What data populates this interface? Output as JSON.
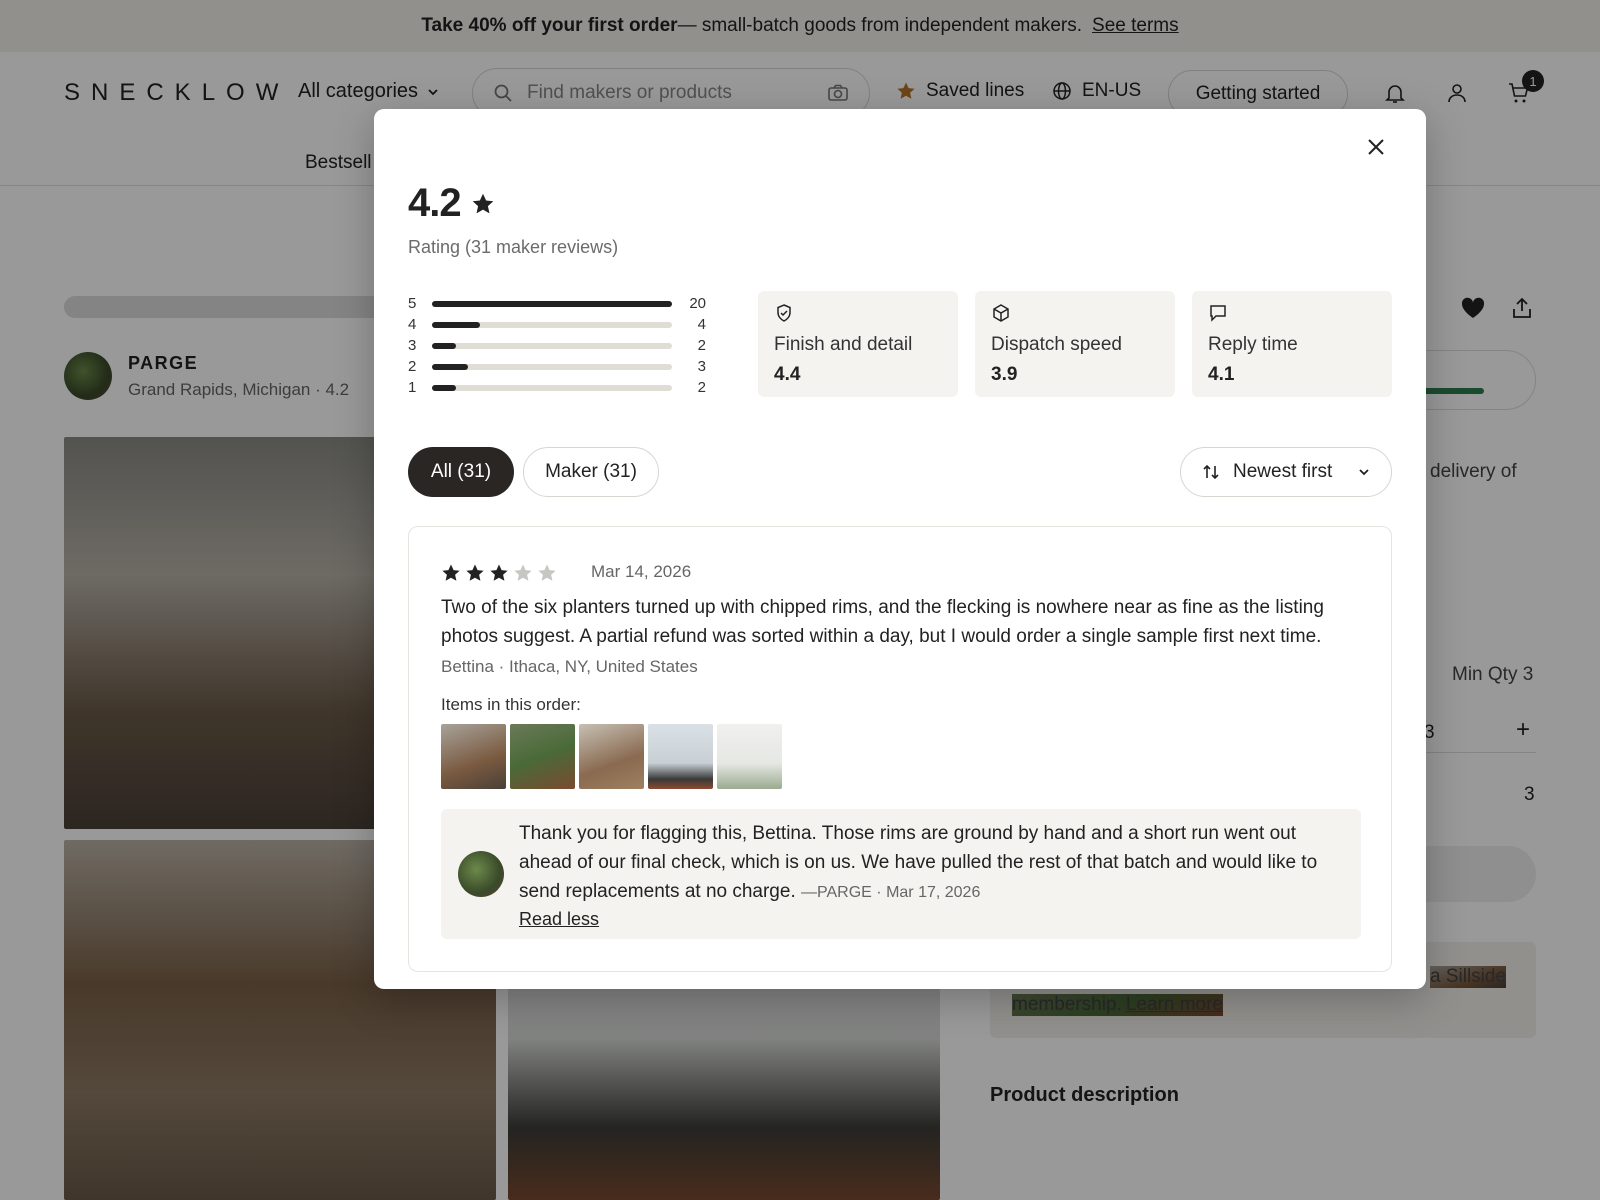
{
  "promo": {
    "bold": "Take 40% off your first order",
    "rest": " — small-batch goods from independent makers.",
    "link": "See terms"
  },
  "header": {
    "logo": "SNECKLOW",
    "categories_label": "All categories",
    "search_placeholder": "Find makers or products",
    "saved_label": "Saved lines",
    "locale": "EN-US",
    "getting_started": "Getting started",
    "cart_count": "1",
    "nav_item": "Bestsell"
  },
  "maker": {
    "name": "PARGE",
    "location": "Grand Rapids, Michigan · 4.2"
  },
  "right_panel": {
    "delivery_fragment": "delivery of",
    "min_qty": "Min Qty 3",
    "qty_fragment": "3",
    "total_qty": "3",
    "membership_fragment": "a Sillside",
    "membership_line2": "membership.",
    "learn_more": "Learn more",
    "product_description": "Product description"
  },
  "modal": {
    "rating_value": "4.2",
    "rating_caption": "Rating (31 maker reviews)",
    "distribution": [
      {
        "stars": "5",
        "count": "20",
        "fraction": 1.0
      },
      {
        "stars": "4",
        "count": "4",
        "fraction": 0.2
      },
      {
        "stars": "3",
        "count": "2",
        "fraction": 0.1
      },
      {
        "stars": "2",
        "count": "3",
        "fraction": 0.15
      },
      {
        "stars": "1",
        "count": "2",
        "fraction": 0.1
      }
    ],
    "metrics": [
      {
        "icon": "shield-check-icon",
        "label": "Finish and detail",
        "value": "4.4"
      },
      {
        "icon": "box-icon",
        "label": "Dispatch speed",
        "value": "3.9"
      },
      {
        "icon": "chat-bubble-icon",
        "label": "Reply time",
        "value": "4.1"
      }
    ],
    "filters": {
      "all": "All (31)",
      "maker": "Maker (31)"
    },
    "sort_label": "Newest first",
    "review": {
      "star_rating": 3,
      "date": "Mar 14, 2026",
      "body": "Two of the six planters turned up with chipped rims, and the flecking is nowhere near as fine as the listing photos suggest. A partial refund was sorted within a day, but I would order a single sample first next time.",
      "author": "Bettina · Ithaca, NY, United States",
      "items_label": "Items in this order:",
      "reply_text": "Thank you for flagging this, Bettina. Those rims are ground by hand and a short run went out ahead of our final check, which is on us. We have pulled the rest of that batch and would like to send replacements at no charge.",
      "reply_meta": "—PARGE · Mar 17, 2026",
      "read_less": "Read less"
    }
  }
}
